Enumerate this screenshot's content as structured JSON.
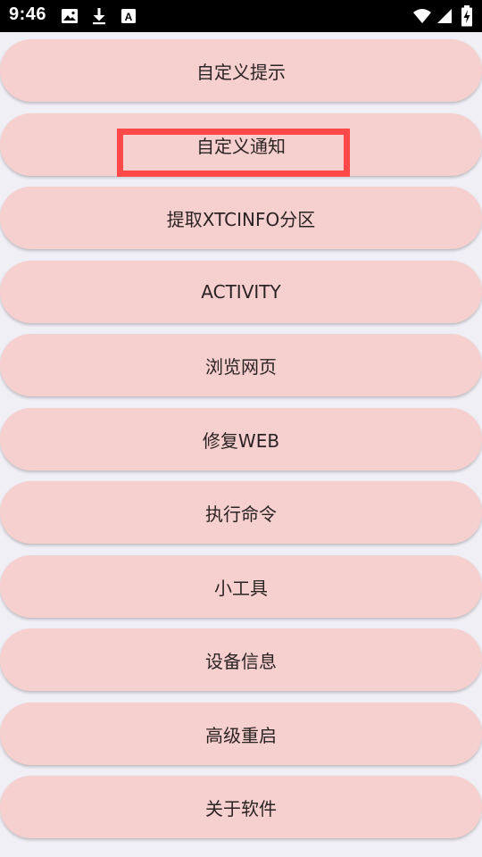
{
  "status_bar": {
    "time": "9:46",
    "icons": [
      "image-icon",
      "download-icon",
      "font-icon"
    ],
    "right_icons": [
      "wifi-icon",
      "signal-icon",
      "battery-charging-icon"
    ]
  },
  "menu": {
    "items": [
      {
        "label": "自定义提示"
      },
      {
        "label": "自定义通知"
      },
      {
        "label": "提取XTCINFO分区"
      },
      {
        "label": "ACTIVITY"
      },
      {
        "label": "浏览网页"
      },
      {
        "label": "修复WEB"
      },
      {
        "label": "执行命令"
      },
      {
        "label": "小工具"
      },
      {
        "label": "设备信息"
      },
      {
        "label": "高级重启"
      },
      {
        "label": "关于软件"
      }
    ]
  },
  "colors": {
    "button_bg": "#f6d0ce",
    "page_bg": "#f1eff6",
    "highlight": "#ff4848"
  }
}
